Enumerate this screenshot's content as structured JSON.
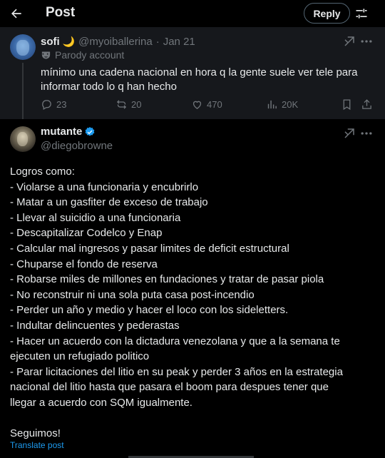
{
  "header": {
    "title": "Post",
    "reply_label": "Reply"
  },
  "icons": {
    "back": "arrow-left-icon",
    "tune": "sliders-icon",
    "grok": "grok-icon",
    "more": "more-icon",
    "reply": "reply-icon",
    "repost": "repost-icon",
    "like": "heart-icon",
    "views": "views-icon",
    "bookmark": "bookmark-icon",
    "share": "share-icon",
    "verified": "verified-badge-icon",
    "parody": "parody-mask-icon"
  },
  "colors": {
    "accent": "#1d9bf0",
    "muted": "#71767b",
    "text": "#e7e9ea",
    "parent_bg": "#16181c"
  },
  "parent_post": {
    "display_name": "sofi",
    "handle": "@myoiballerina",
    "separator": "·",
    "date": "Jan 21",
    "badge": "Parody account",
    "text": "mínimo una cadena nacional en hora q la gente suele ver tele para informar todo lo q han hecho",
    "stats": {
      "replies": "23",
      "reposts": "20",
      "likes": "470",
      "views": "20K"
    }
  },
  "main_post": {
    "display_name": "mutante",
    "handle": "@diegobrowne",
    "lines": [
      "Logros como:",
      "- Violarse a una funcionaria y encubrirlo",
      "- Matar a un gasfiter de exceso de trabajo",
      "- Llevar al suicidio a una funcionaria",
      "- Descapitalizar Codelco y Enap",
      "- Calcular mal ingresos y pasar limites de deficit estructural",
      "- Chuparse el fondo de reserva",
      "- Robarse miles de millones en fundaciones y tratar de pasar piola",
      "- No reconstruir ni una sola puta casa post-incendio",
      "- Perder un año y medio y hacer el loco con los sideletters.",
      "- Indultar delincuentes y pederastas",
      "- Hacer un acuerdo con la dictadura venezolana y que a la semana te",
      "ejecuten un refugiado politico",
      "- Parar licitaciones del litio en su peak y perder 3 años en la estrategia",
      "nacional del litio hasta que pasara el boom para despues tener que",
      "llegar a acuerdo con SQM igualmente.",
      "",
      "Seguimos!"
    ],
    "translate_label": "Translate post"
  }
}
